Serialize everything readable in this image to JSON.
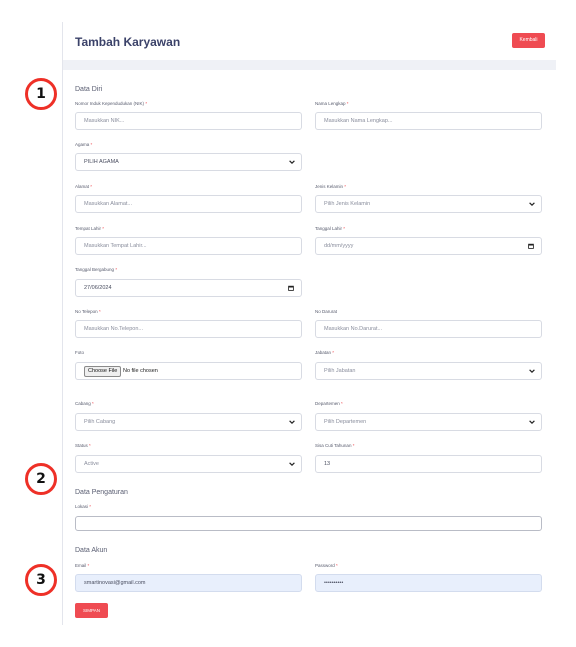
{
  "header": {
    "title": "Tambah Karyawan",
    "back_label": "Kembali"
  },
  "markers": [
    "1",
    "2",
    "3"
  ],
  "sections": {
    "data_diri": "Data Diri",
    "data_pengaturan": "Data Pengaturan",
    "data_akun": "Data Akun"
  },
  "form": {
    "nik": {
      "label": "Nomor Induk Kependudukan (NIK)",
      "placeholder": "Masukkan NIK..."
    },
    "nama": {
      "label": "Nama Lengkap",
      "placeholder": "Masukkan Nama Lengkap..."
    },
    "agama": {
      "label": "Agama",
      "value": "PILIH AGAMA"
    },
    "alamat": {
      "label": "Alamat",
      "placeholder": "Masukkan Alamat..."
    },
    "jenis_kelamin": {
      "label": "Jenis Kelamin",
      "value": "Pilih Jenis Kelamin"
    },
    "tempat_lahir": {
      "label": "Tempat Lahir",
      "placeholder": "Masukkan Tempat Lahir..."
    },
    "tanggal_lahir": {
      "label": "Tanggal Lahir",
      "value": "dd/mm/yyyy"
    },
    "tanggal_bergabung": {
      "label": "Tanggal Bergabung",
      "value": "27/06/2024"
    },
    "no_telepon": {
      "label": "No Telepon",
      "placeholder": "Masukkan No.Telepon..."
    },
    "no_darurat": {
      "label": "No Darurat",
      "placeholder": "Masukkan No.Darurat..."
    },
    "foto": {
      "label": "Foto",
      "button": "Choose File",
      "status": "No file chosen"
    },
    "jabatan": {
      "label": "Jabatan",
      "value": "Pilih Jabatan"
    },
    "cabang": {
      "label": "Cabang",
      "value": "Pilih Cabang"
    },
    "departemen": {
      "label": "Departemen",
      "value": "Pilih Departemen"
    },
    "status": {
      "label": "Status",
      "value": "Active"
    },
    "sisa_cuti": {
      "label": "Sisa Cuti Tahunan",
      "value": "13"
    },
    "lokasi": {
      "label": "Lokasi",
      "value": ""
    },
    "email": {
      "label": "Email",
      "value": "smartinovasi@gmail.com"
    },
    "password": {
      "label": "Password",
      "value": "••••••••••"
    }
  },
  "required_mark": "*",
  "save_label": "SIMPAN",
  "colors": {
    "accent": "#ef4b52",
    "marker": "#ee3027",
    "title": "#3b4269",
    "autofill": "#e8effc"
  }
}
